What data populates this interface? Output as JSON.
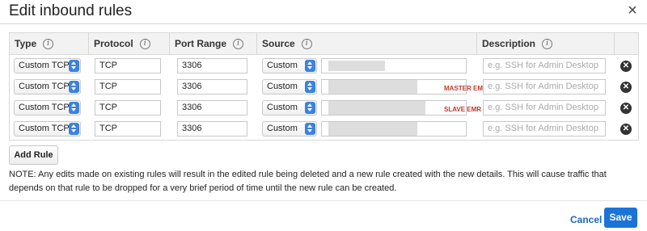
{
  "dialog": {
    "title": "Edit inbound rules",
    "close_glyph": "×"
  },
  "table": {
    "headers": {
      "type": "Type",
      "protocol": "Protocol",
      "port_range": "Port Range",
      "source": "Source",
      "description": "Description"
    },
    "info_glyph": "i",
    "rows": [
      {
        "type": "Custom TCP",
        "protocol": "TCP",
        "port_range": "3306",
        "source_type": "Custom",
        "source_label": "",
        "description_placeholder": "e.g. SSH for Admin Desktop"
      },
      {
        "type": "Custom TCP",
        "protocol": "TCP",
        "port_range": "3306",
        "source_type": "Custom",
        "source_label": "MASTER EMR Group",
        "description_placeholder": "e.g. SSH for Admin Desktop"
      },
      {
        "type": "Custom TCP",
        "protocol": "TCP",
        "port_range": "3306",
        "source_type": "Custom",
        "source_label": "SLAVE EMR Group",
        "description_placeholder": "e.g. SSH for Admin Desktop"
      },
      {
        "type": "Custom TCP",
        "protocol": "TCP",
        "port_range": "3306",
        "source_type": "Custom",
        "source_label": "",
        "description_placeholder": "e.g. SSH for Admin Desktop"
      }
    ],
    "remove_glyph": "✕"
  },
  "actions": {
    "add_rule": "Add Rule",
    "cancel": "Cancel",
    "save": "Save"
  },
  "note": "NOTE: Any edits made on existing rules will result in the edited rule being deleted and a new rule created with the new details. This will cause traffic that depends on that rule to be dropped for a very brief period of time until the new rule can be created.",
  "colors": {
    "accent": "#1a73d9",
    "link": "#1a66c2",
    "group_label": "#c0392b"
  }
}
